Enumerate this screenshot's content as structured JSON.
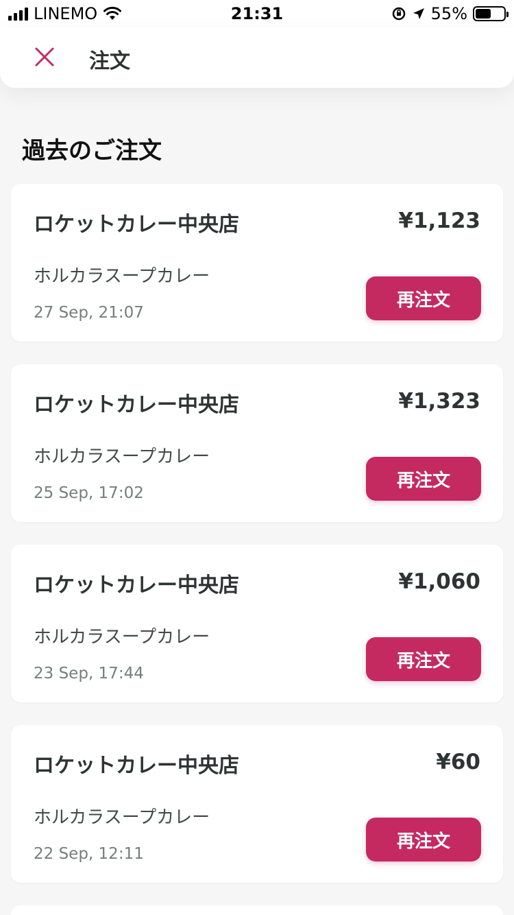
{
  "status": {
    "carrier": "LINEMO",
    "time": "21:31",
    "battery_percent_label": "55%",
    "battery_level": 0.55
  },
  "header": {
    "title": "注文"
  },
  "section_title": "過去のご注文",
  "orders": [
    {
      "restaurant": "ロケットカレー中央店",
      "price": "¥1,123",
      "item": "ホルカラスープカレー",
      "date": "27 Sep, 21:07",
      "reorder": "再注文"
    },
    {
      "restaurant": "ロケットカレー中央店",
      "price": "¥1,323",
      "item": "ホルカラスープカレー",
      "date": "25 Sep, 17:02",
      "reorder": "再注文"
    },
    {
      "restaurant": "ロケットカレー中央店",
      "price": "¥1,060",
      "item": "ホルカラスープカレー",
      "date": "23 Sep, 17:44",
      "reorder": "再注文"
    },
    {
      "restaurant": "ロケットカレー中央店",
      "price": "¥60",
      "item": "ホルカラスープカレー",
      "date": "22 Sep, 12:11",
      "reorder": "再注文"
    }
  ],
  "colors": {
    "accent": "#c42a5f",
    "background": "#f6f6f6"
  }
}
